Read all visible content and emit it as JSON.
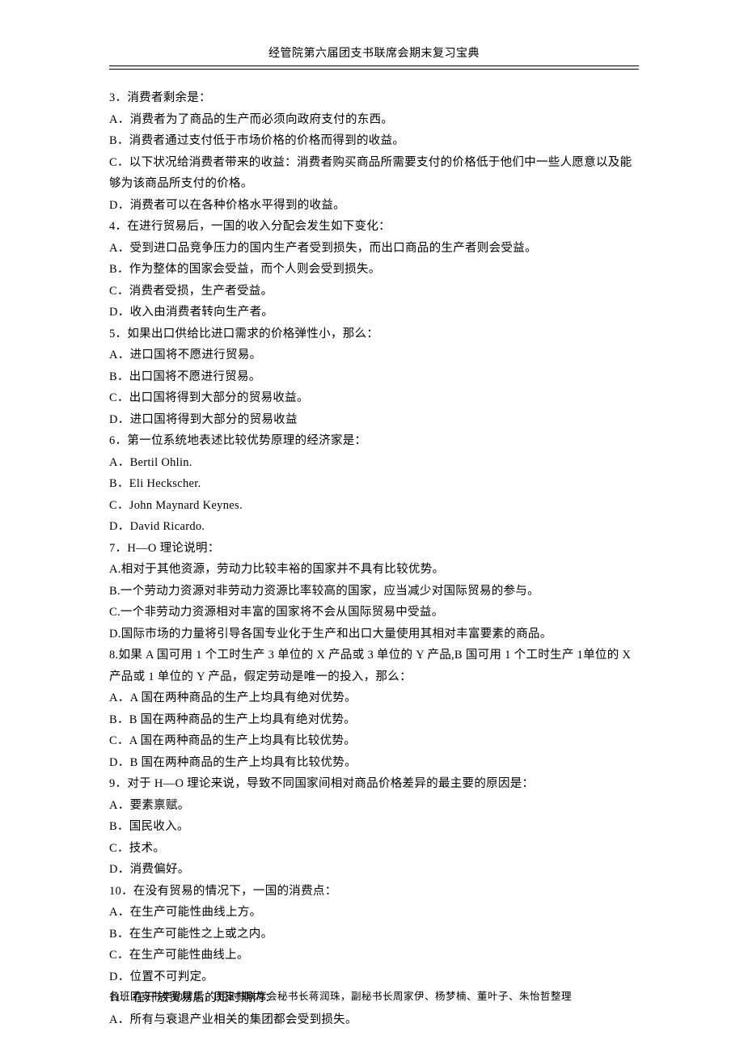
{
  "header": "经管院第六届团支书联席会期末复习宝典",
  "footer": "各班团支书辛勤搜集，团支书联席会秘书长蒋润珠，副秘书长周家伊、杨梦楠、董叶子、朱怡哲整理",
  "lines": [
    "3．消费者剩余是：",
    "A．消费者为了商品的生产而必须向政府支付的东西。",
    "B．消费者通过支付低于市场价格的价格而得到的收益。",
    "C．以下状况给消费者带来的收益：消费者购买商品所需要支付的价格低于他们中一些人愿意以及能够为该商品所支付的价格。",
    "D．消费者可以在各种价格水平得到的收益。",
    "4．在进行贸易后，一国的收入分配会发生如下变化：",
    "A．受到进口品竞争压力的国内生产者受到损失，而出口商品的生产者则会受益。",
    "B．作为整体的国家会受益，而个人则会受到损失。",
    "C．消费者受损，生产者受益。",
    "D．收入由消费者转向生产者。",
    "5．如果出口供给比进口需求的价格弹性小，那么：",
    "A．进口国将不愿进行贸易。",
    "B．出口国将不愿进行贸易。",
    "C．出口国将得到大部分的贸易收益。",
    "D．进口国将得到大部分的贸易收益",
    "6．第一位系统地表述比较优势原理的经济家是：",
    "A．Bertil Ohlin.",
    "B．Eli Heckscher.",
    "C．John Maynard Keynes.",
    "D．David Ricardo.",
    "7．H—O 理论说明：",
    "A.相对于其他资源，劳动力比较丰裕的国家并不具有比较优势。",
    "B.一个劳动力资源对非劳动力资源比率较高的国家，应当减少对国际贸易的参与。",
    "C.一个非劳动力资源相对丰富的国家将不会从国际贸易中受益。",
    "D.国际市场的力量将引导各国专业化于生产和出口大量使用其相对丰富要素的商品。",
    "8.如果 A 国可用 1 个工时生产 3 单位的 X 产品或 3 单位的 Y 产品,B 国可用 1 个工时生产 1单位的 X 产品或 1 单位的 Y 产品，假定劳动是唯一的投入，那么：",
    "A．A 国在两种商品的生产上均具有绝对优势。",
    "B．B 国在两种商品的生产上均具有绝对优势。",
    "C．A 国在两种商品的生产上均具有比较优势。",
    "D．B 国在两种商品的生产上均具有比较优势。",
    "9．对于 H—O 理论来说，导致不同国家间相对商品价格差异的最主要的原因是：",
    "A．要素禀赋。",
    "B．国民收入。",
    "C．技术。",
    "D．消费偏好。",
    "10．在没有贸易的情况下，一国的消费点：",
    "A．在生产可能性曲线上方。",
    "B．在生产可能性之上或之内。",
    "C．在生产可能性曲线上。",
    "D．位置不可判定。",
    "11．在开放贸易后的短时期内：",
    "A．所有与衰退产业相关的集团都会受到损失。"
  ]
}
